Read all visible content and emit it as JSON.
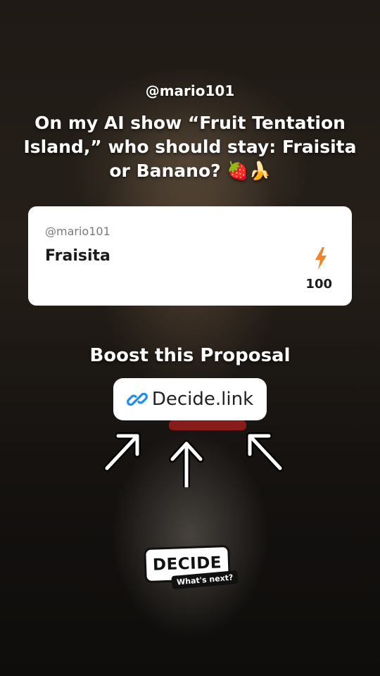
{
  "post": {
    "username": "@mario101",
    "question": "On my AI show “Fruit Tentation Island,” who should stay: Fraisita or Banano? 🍓🍌"
  },
  "proposal_card": {
    "username": "@mario101",
    "title": "Fraisita",
    "icon": "lightning-bolt-icon",
    "boost_count": "100",
    "accent_color": "#f0842a"
  },
  "cta": {
    "title": "Boost this Proposal",
    "link_icon": "link-icon",
    "link_label": "Decide.link",
    "link_color": "#1f8ef1"
  },
  "branding": {
    "logo_text": "DECIDE",
    "tagline": "What's next?"
  }
}
